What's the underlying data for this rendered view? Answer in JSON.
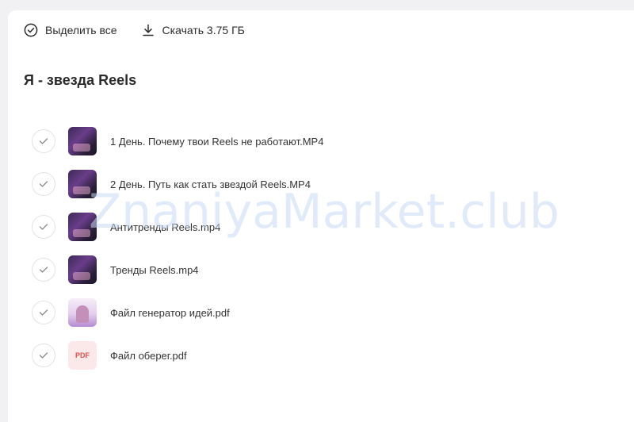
{
  "toolbar": {
    "select_all_label": "Выделить все",
    "select_all_icon": "check-circle-icon",
    "download_label": "Скачать 3.75 ГБ",
    "download_icon": "download-icon"
  },
  "folder": {
    "title": "Я - звезда Reels"
  },
  "files": [
    {
      "name": "1 День. Почему твои Reels не работают.MP4",
      "thumb": "video"
    },
    {
      "name": "2 День. Путь как стать звездой Reels.MP4",
      "thumb": "video"
    },
    {
      "name": "Антитренды Reels.mp4",
      "thumb": "video"
    },
    {
      "name": "Тренды Reels.mp4",
      "thumb": "video"
    },
    {
      "name": "Файл генератор идей.pdf",
      "thumb": "doc"
    },
    {
      "name": "Файл оберег.pdf",
      "thumb": "pdf",
      "thumb_label": "PDF"
    }
  ],
  "watermark": "ZnaniyaMarket.club",
  "colors": {
    "background": "#f1f1f3",
    "panel": "#ffffff",
    "text": "#333333",
    "pdf_accent": "#d9534f",
    "watermark": "#c9daf5"
  }
}
